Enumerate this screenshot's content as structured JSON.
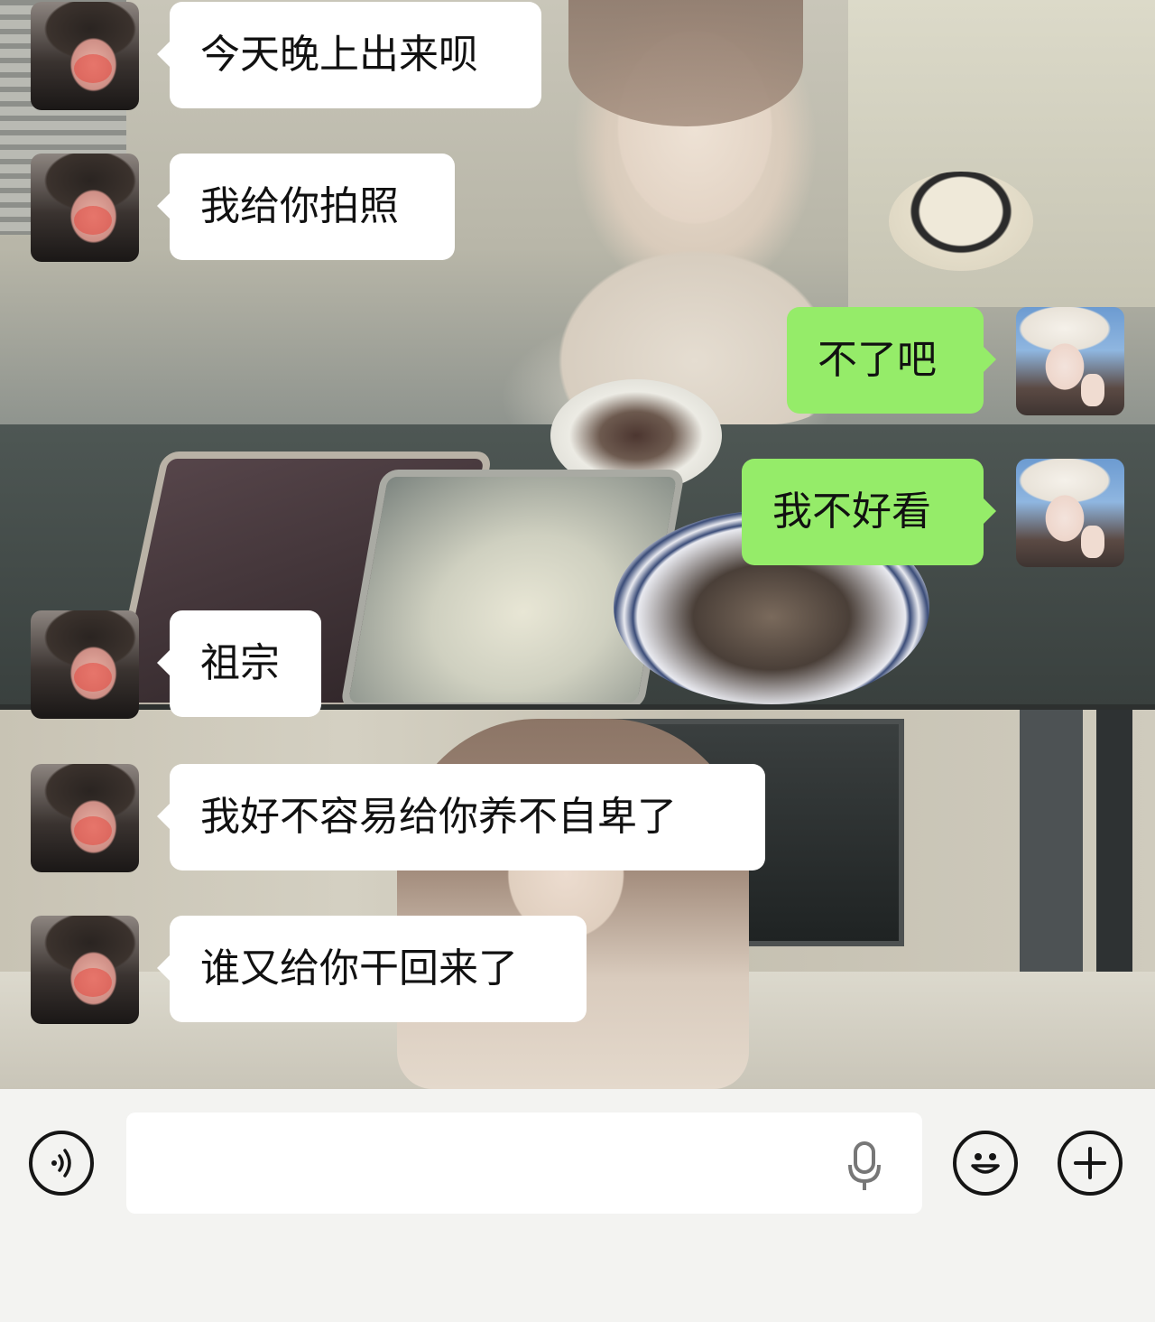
{
  "messages": [
    {
      "sender": "contact",
      "text": "今天晚上出来呗"
    },
    {
      "sender": "contact",
      "text": "我给你拍照"
    },
    {
      "sender": "self",
      "text": "不了吧"
    },
    {
      "sender": "self",
      "text": "我不好看"
    },
    {
      "sender": "contact",
      "text": "祖宗"
    },
    {
      "sender": "contact",
      "text": "我好不容易给你养不自卑了"
    },
    {
      "sender": "contact",
      "text": "谁又给你干回来了"
    }
  ],
  "input_bar": {
    "voice_icon": "voice-wave-icon",
    "mic_icon": "microphone-icon",
    "emoji_icon": "smiley-face-icon",
    "plus_icon": "plus-icon",
    "message_value": ""
  },
  "colors": {
    "self_bubble": "#95ec69",
    "contact_bubble": "#ffffff",
    "input_bar_bg": "#f3f3f1"
  }
}
